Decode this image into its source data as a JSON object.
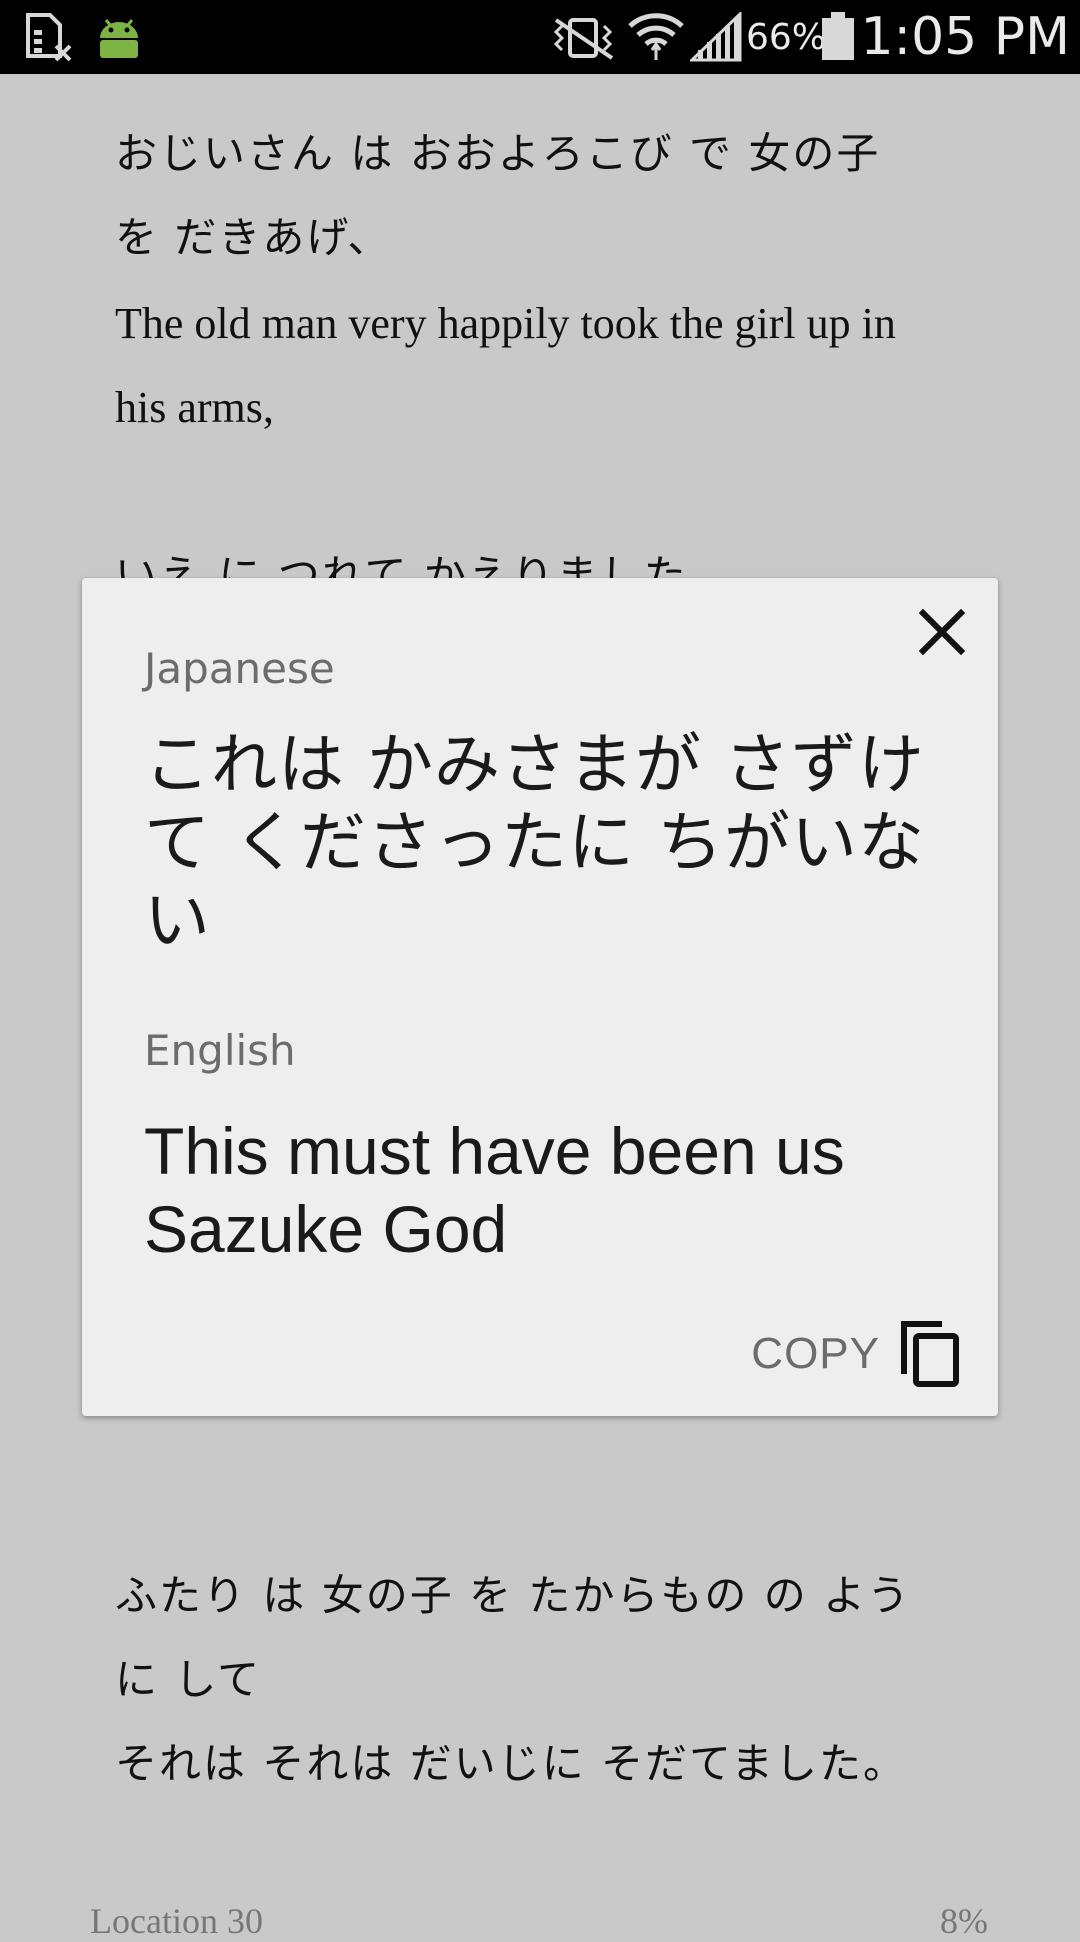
{
  "status_bar": {
    "battery_percent": "66%",
    "time": "1:05 PM",
    "icons": [
      "file-x-icon",
      "android-icon",
      "vibrate-mute-icon",
      "wifi-icon",
      "signal-icon",
      "battery-icon"
    ]
  },
  "reader": {
    "paragraphs": [
      {
        "jp_line1": "おじいさん は おおよろこび で 女の子",
        "jp_line2": "を だきあげ、"
      },
      {
        "en_line1": "The old man very happily took the girl up in",
        "en_line2": "his arms,"
      },
      {
        "jp_line1": "いえ に つれて かえりました。"
      },
      {
        "jp_line1": "ふたり は 女の子 を たからもの の よう",
        "jp_line2": "に して",
        "jp_line3": "それは それは だいじに そだてました。"
      }
    ],
    "location": "Location 30",
    "progress_percent": "8%"
  },
  "translation_card": {
    "source_label": "Japanese",
    "source_text": "これは かみさまが さずけて くださったに ちがいない",
    "target_label": "English",
    "target_text": "This must have been us Sazuke God",
    "copy_label": "COPY"
  },
  "colors": {
    "status_bar_bg": "#000000",
    "page_dim_bg": "#c9c9c9",
    "card_bg": "#eeeeee",
    "label_gray": "#6c6c6c"
  }
}
